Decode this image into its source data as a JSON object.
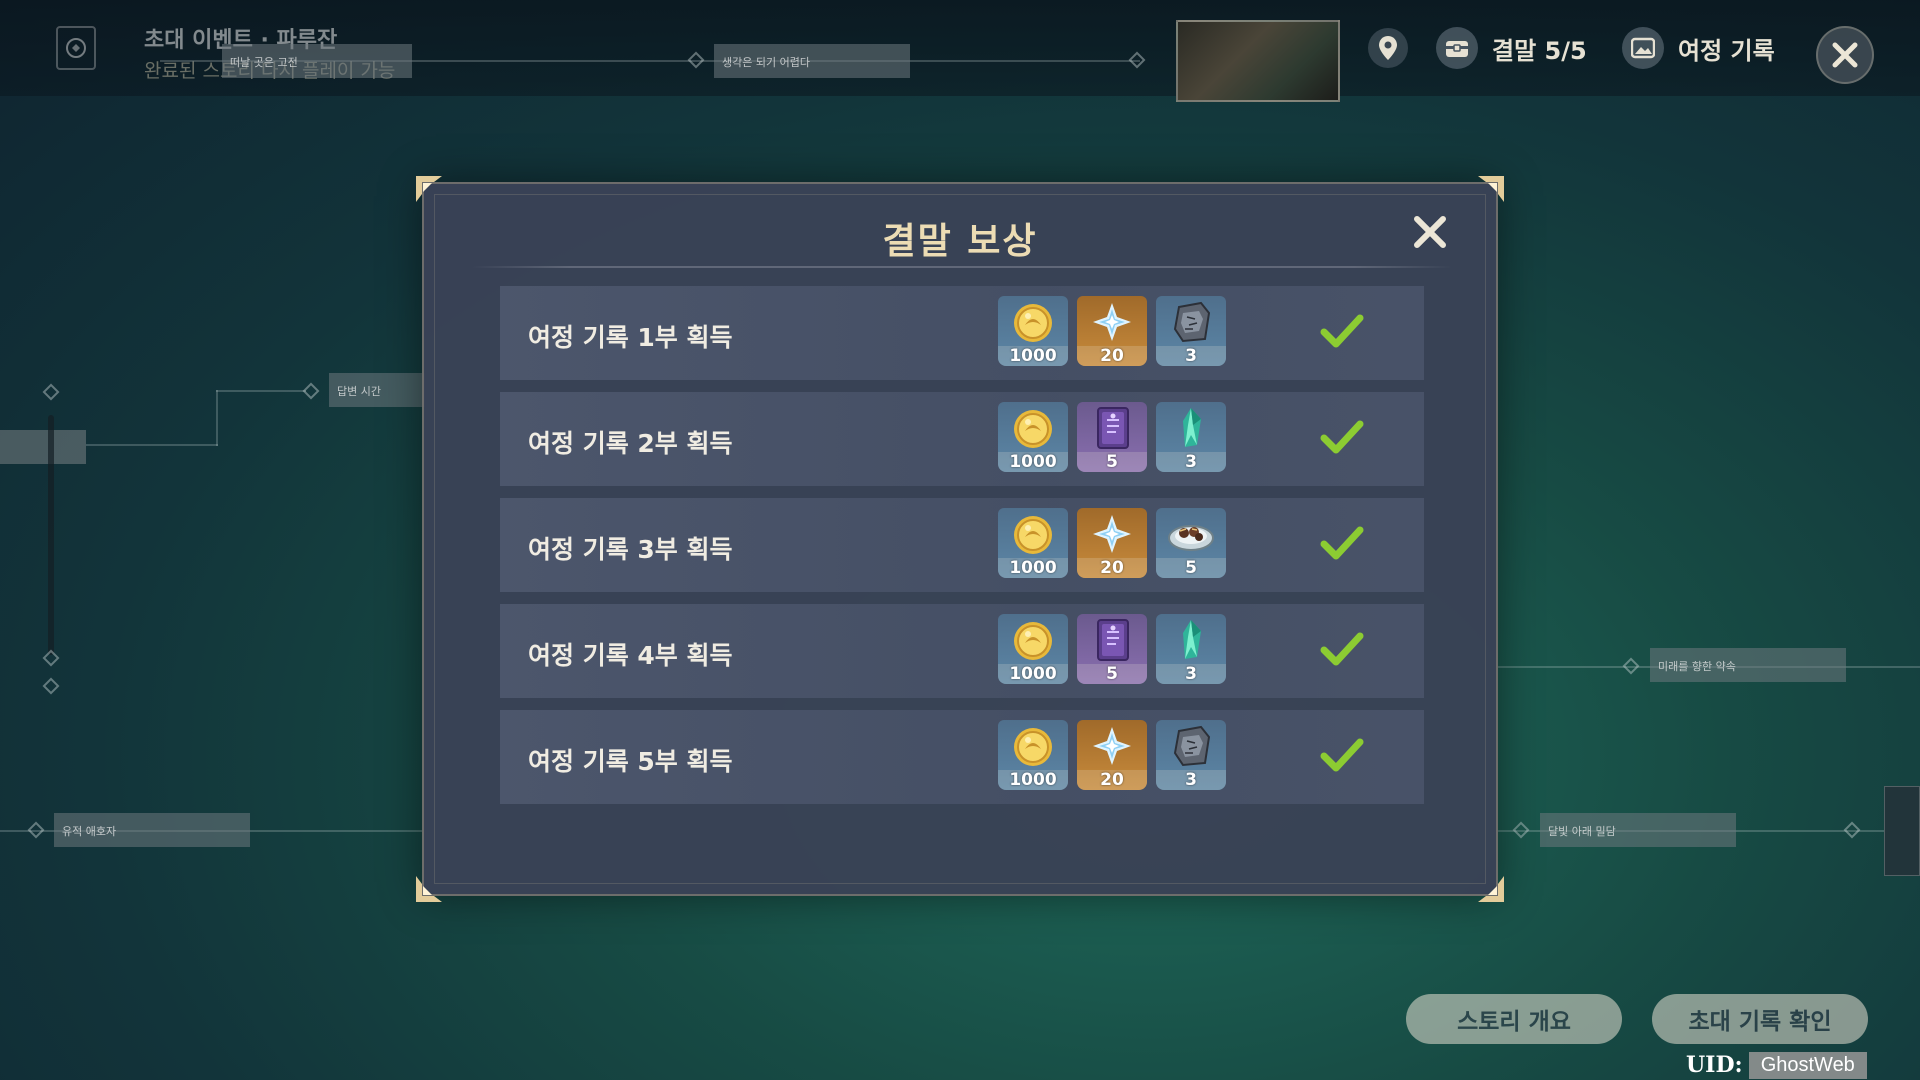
{
  "header": {
    "event_title": "초대 이벤트 · 파루잔",
    "event_subtitle": "완료된 스토리 다시 플레이 가능",
    "ending_label": "결말 5/5",
    "journey_label": "여정 기록"
  },
  "map_nodes": {
    "node_top_1": "떠날 곳은 고전",
    "node_top_2": "생각은 되기 어렵다",
    "node_left_1": "답변 시간",
    "node_left_2": "유적 애호자",
    "node_right_1": "미래를 향한 약속",
    "node_right_2": "달빛 아래 밀담"
  },
  "modal": {
    "title": "결말 보상",
    "rows": [
      {
        "label": "여정 기록 1부 획득",
        "items": [
          {
            "icon": "mora-coin-icon",
            "count": "1000",
            "rarity": "blue"
          },
          {
            "icon": "primogem-icon",
            "count": "20",
            "rarity": "gold"
          },
          {
            "icon": "stone-relic-icon",
            "count": "3",
            "rarity": "blue"
          }
        ],
        "completed": true
      },
      {
        "label": "여정 기록 2부 획득",
        "items": [
          {
            "icon": "mora-coin-icon",
            "count": "1000",
            "rarity": "blue"
          },
          {
            "icon": "exp-book-icon",
            "count": "5",
            "rarity": "purple"
          },
          {
            "icon": "green-crystal-icon",
            "count": "3",
            "rarity": "blue"
          }
        ],
        "completed": true
      },
      {
        "label": "여정 기록 3부 획득",
        "items": [
          {
            "icon": "mora-coin-icon",
            "count": "1000",
            "rarity": "blue"
          },
          {
            "icon": "primogem-icon",
            "count": "20",
            "rarity": "gold"
          },
          {
            "icon": "food-dish-icon",
            "count": "5",
            "rarity": "blue"
          }
        ],
        "completed": true
      },
      {
        "label": "여정 기록 4부 획득",
        "items": [
          {
            "icon": "mora-coin-icon",
            "count": "1000",
            "rarity": "blue"
          },
          {
            "icon": "exp-book-icon",
            "count": "5",
            "rarity": "purple"
          },
          {
            "icon": "green-crystal-icon",
            "count": "3",
            "rarity": "blue"
          }
        ],
        "completed": true
      },
      {
        "label": "여정 기록 5부 획득",
        "items": [
          {
            "icon": "mora-coin-icon",
            "count": "1000",
            "rarity": "blue"
          },
          {
            "icon": "primogem-icon",
            "count": "20",
            "rarity": "gold"
          },
          {
            "icon": "stone-relic-icon",
            "count": "3",
            "rarity": "blue"
          }
        ],
        "completed": true
      }
    ]
  },
  "buttons": {
    "story_summary": "스토리 개요",
    "invitation_record": "초대 기록 확인"
  },
  "uid": {
    "label": "UID:",
    "value": "GhostWeb"
  },
  "colors": {
    "title_gold": "#ecdcb4",
    "check_green": "#8ccc32",
    "modal_bg": "#3a4256"
  }
}
